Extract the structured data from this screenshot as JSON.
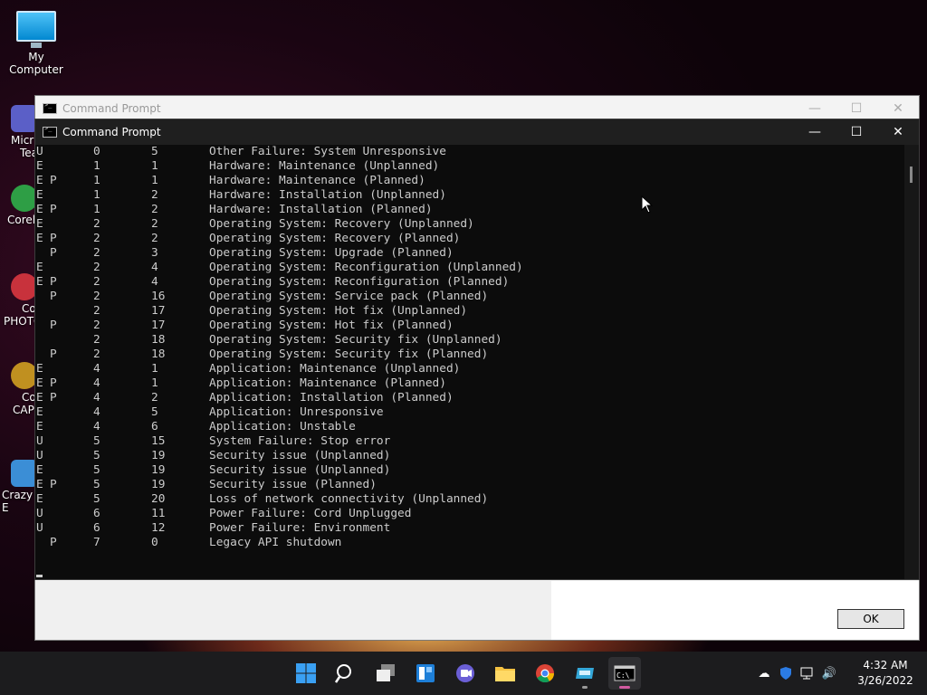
{
  "desktop": {
    "my_computer": "My Computer",
    "side_icons": [
      {
        "label": "Micr",
        "label2": "Tea",
        "color": "#5b5fc7"
      },
      {
        "label": "Corell",
        "color": "#2e9e45"
      },
      {
        "label": "Co",
        "label2": "PHOTO",
        "color": "#c8323c"
      },
      {
        "label": "Co",
        "label2": "CAP",
        "color": "#c09020"
      },
      {
        "label": "Crazy E",
        "color": "#3b8ed6"
      }
    ]
  },
  "back_window": {
    "title": "Command Prompt",
    "ok_label": "OK"
  },
  "front_window": {
    "title": "Command Prompt",
    "rows": [
      [
        "U",
        "",
        "0",
        "5",
        "Other Failure: System Unresponsive"
      ],
      [
        "E",
        "",
        "1",
        "1",
        "Hardware: Maintenance (Unplanned)"
      ],
      [
        "E",
        "P",
        "1",
        "1",
        "Hardware: Maintenance (Planned)"
      ],
      [
        "E",
        "",
        "1",
        "2",
        "Hardware: Installation (Unplanned)"
      ],
      [
        "E",
        "P",
        "1",
        "2",
        "Hardware: Installation (Planned)"
      ],
      [
        "E",
        "",
        "2",
        "2",
        "Operating System: Recovery (Unplanned)"
      ],
      [
        "E",
        "P",
        "2",
        "2",
        "Operating System: Recovery (Planned)"
      ],
      [
        "",
        "P",
        "2",
        "3",
        "Operating System: Upgrade (Planned)"
      ],
      [
        "E",
        "",
        "2",
        "4",
        "Operating System: Reconfiguration (Unplanned)"
      ],
      [
        "E",
        "P",
        "2",
        "4",
        "Operating System: Reconfiguration (Planned)"
      ],
      [
        "",
        "P",
        "2",
        "16",
        "Operating System: Service pack (Planned)"
      ],
      [
        "",
        "",
        "2",
        "17",
        "Operating System: Hot fix (Unplanned)"
      ],
      [
        "",
        "P",
        "2",
        "17",
        "Operating System: Hot fix (Planned)"
      ],
      [
        "",
        "",
        "2",
        "18",
        "Operating System: Security fix (Unplanned)"
      ],
      [
        "",
        "P",
        "2",
        "18",
        "Operating System: Security fix (Planned)"
      ],
      [
        "E",
        "",
        "4",
        "1",
        "Application: Maintenance (Unplanned)"
      ],
      [
        "E",
        "P",
        "4",
        "1",
        "Application: Maintenance (Planned)"
      ],
      [
        "E",
        "P",
        "4",
        "2",
        "Application: Installation (Planned)"
      ],
      [
        "E",
        "",
        "4",
        "5",
        "Application: Unresponsive"
      ],
      [
        "E",
        "",
        "4",
        "6",
        "Application: Unstable"
      ],
      [
        "U",
        "",
        "5",
        "15",
        "System Failure: Stop error"
      ],
      [
        "U",
        "",
        "5",
        "19",
        "Security issue (Unplanned)"
      ],
      [
        "E",
        "",
        "5",
        "19",
        "Security issue (Unplanned)"
      ],
      [
        "E",
        "P",
        "5",
        "19",
        "Security issue (Planned)"
      ],
      [
        "E",
        "",
        "5",
        "20",
        "Loss of network connectivity (Unplanned)"
      ],
      [
        "U",
        "",
        "6",
        "11",
        "Power Failure: Cord Unplugged"
      ],
      [
        "U",
        "",
        "6",
        "12",
        "Power Failure: Environment"
      ],
      [
        "",
        "P",
        "7",
        "0",
        "Legacy API shutdown"
      ]
    ]
  },
  "taskbar": {
    "time": "4:32 AM",
    "date": "3/26/2022"
  }
}
